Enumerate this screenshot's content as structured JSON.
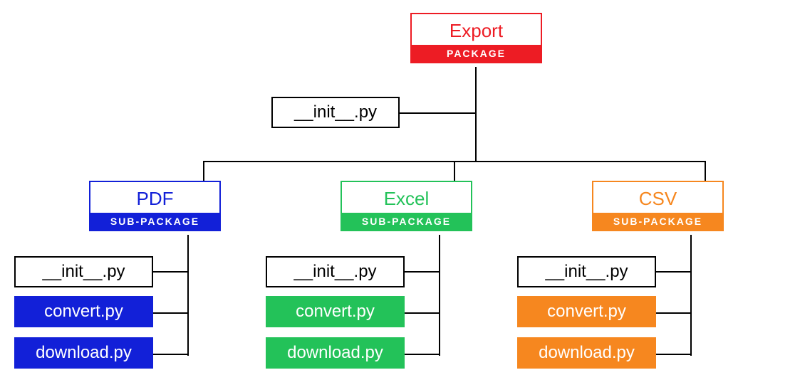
{
  "root": {
    "title": "Export",
    "sub": "PACKAGE",
    "init": "__init__.py"
  },
  "children": [
    {
      "title": "PDF",
      "sub": "SUB-PACKAGE",
      "color": "#1220d8",
      "files": [
        "__init__.py",
        "convert.py",
        "download.py"
      ]
    },
    {
      "title": "Excel",
      "sub": "SUB-PACKAGE",
      "color": "#23c259",
      "files": [
        "__init__.py",
        "convert.py",
        "download.py"
      ]
    },
    {
      "title": "CSV",
      "sub": "SUB-PACKAGE",
      "color": "#f6871f",
      "files": [
        "__init__.py",
        "convert.py",
        "download.py"
      ]
    }
  ],
  "colors": {
    "root": "#ed1c24"
  }
}
